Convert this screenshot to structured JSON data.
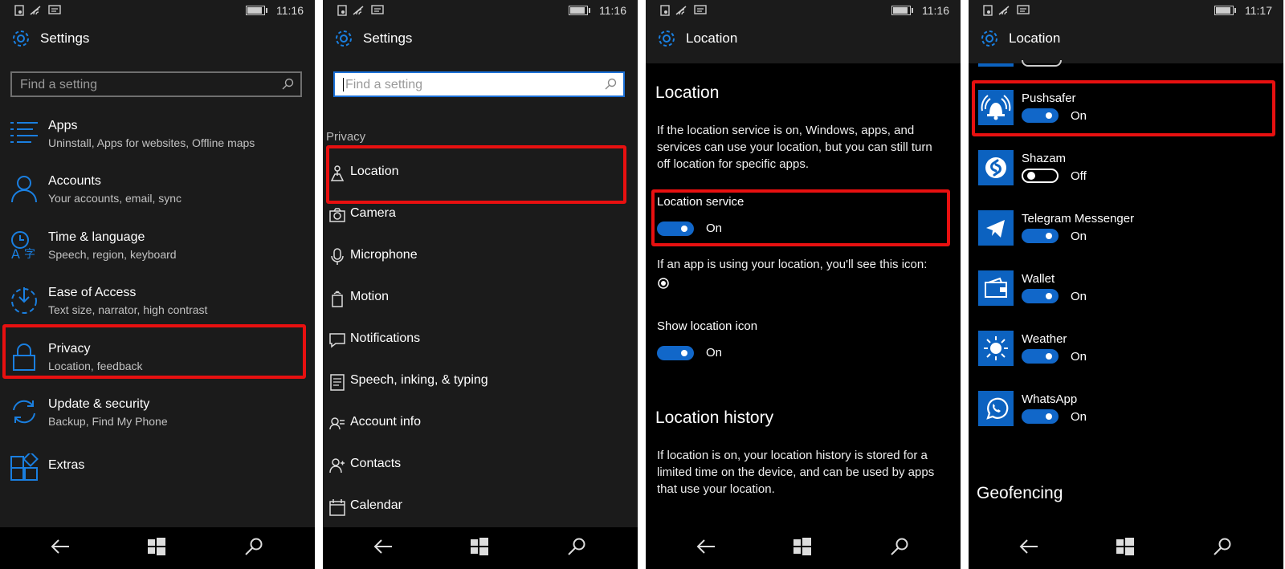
{
  "time_1": "11:16",
  "time_2": "11:16",
  "time_3": "11:16",
  "time_4": "11:17",
  "panel1": {
    "title": "Settings",
    "search_placeholder": "Find a setting",
    "items": [
      {
        "title": "Apps",
        "sub": "Uninstall, Apps for websites, Offline maps"
      },
      {
        "title": "Accounts",
        "sub": "Your accounts, email, sync"
      },
      {
        "title": "Time & language",
        "sub": "Speech, region, keyboard"
      },
      {
        "title": "Ease of Access",
        "sub": "Text size, narrator, high contrast"
      },
      {
        "title": "Privacy",
        "sub": "Location, feedback"
      },
      {
        "title": "Update & security",
        "sub": "Backup, Find My Phone"
      },
      {
        "title": "Extras",
        "sub": ""
      }
    ]
  },
  "panel2": {
    "title": "Settings",
    "search_placeholder": "Find a setting",
    "section": "Privacy",
    "items": [
      "Location",
      "Camera",
      "Microphone",
      "Motion",
      "Notifications",
      "Speech, inking, & typing",
      "Account info",
      "Contacts",
      "Calendar"
    ]
  },
  "panel3": {
    "title": "Location",
    "heading": "Location",
    "desc": "If the location service is on, Windows, apps, and services can use your location, but you can still turn off location for specific apps.",
    "service_label": "Location service",
    "service_state": "On",
    "icon_note": "If an app is using your location, you'll see this icon:",
    "show_icon_label": "Show location icon",
    "show_icon_state": "On",
    "history_heading": "Location history",
    "history_desc": "If location is on, your location history is stored for a limited time on the device, and can be used by apps that use your location."
  },
  "panel4": {
    "title": "Location",
    "apps": [
      {
        "name": "Pushsafer",
        "state": "On",
        "on": true
      },
      {
        "name": "Shazam",
        "state": "Off",
        "on": false
      },
      {
        "name": "Telegram Messenger",
        "state": "On",
        "on": true
      },
      {
        "name": "Wallet",
        "state": "On",
        "on": true
      },
      {
        "name": "Weather",
        "state": "On",
        "on": true
      },
      {
        "name": "WhatsApp",
        "state": "On",
        "on": true
      }
    ],
    "geofencing": "Geofencing"
  },
  "colors": {
    "accent": "#1167c9",
    "highlight": "#e81010",
    "background": "#1b1b1b"
  }
}
